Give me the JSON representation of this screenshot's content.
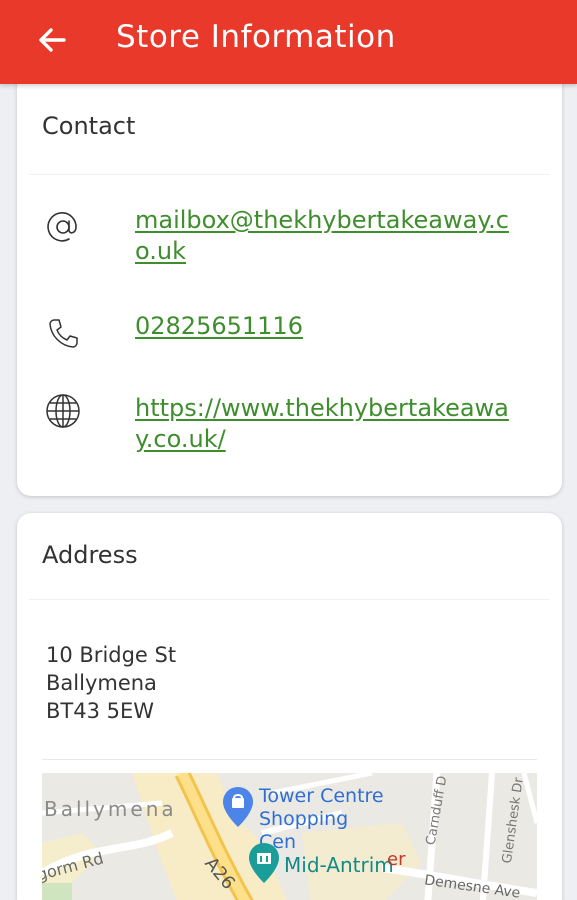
{
  "header": {
    "title": "Store Information",
    "back_icon": "arrow-left-icon",
    "background": "#e8392b"
  },
  "contact": {
    "title": "Contact",
    "email": {
      "icon": "at-sign-icon",
      "value": "mailbox@thekhybertakeaway.co.uk"
    },
    "phone": {
      "icon": "phone-icon",
      "value": "02825651116"
    },
    "website": {
      "icon": "globe-icon",
      "value": "https://www.thekhybertakeaway.co.uk/"
    },
    "link_color": "#3f8e2e"
  },
  "address": {
    "title": "Address",
    "line1": "10 Bridge St",
    "line2": "Ballymena",
    "line3": "BT43 5EW"
  },
  "map": {
    "town_label": "Ballymena",
    "poi_1": "Tower Centre Shopping Cen",
    "poi_2": "Mid-Antrim",
    "road_1": "A26",
    "road_2": "gorm Rd",
    "road_3": "Carnduff D",
    "road_4": "Glenshesk Dr",
    "road_5": "Demesne Ave",
    "road_6": "er"
  }
}
